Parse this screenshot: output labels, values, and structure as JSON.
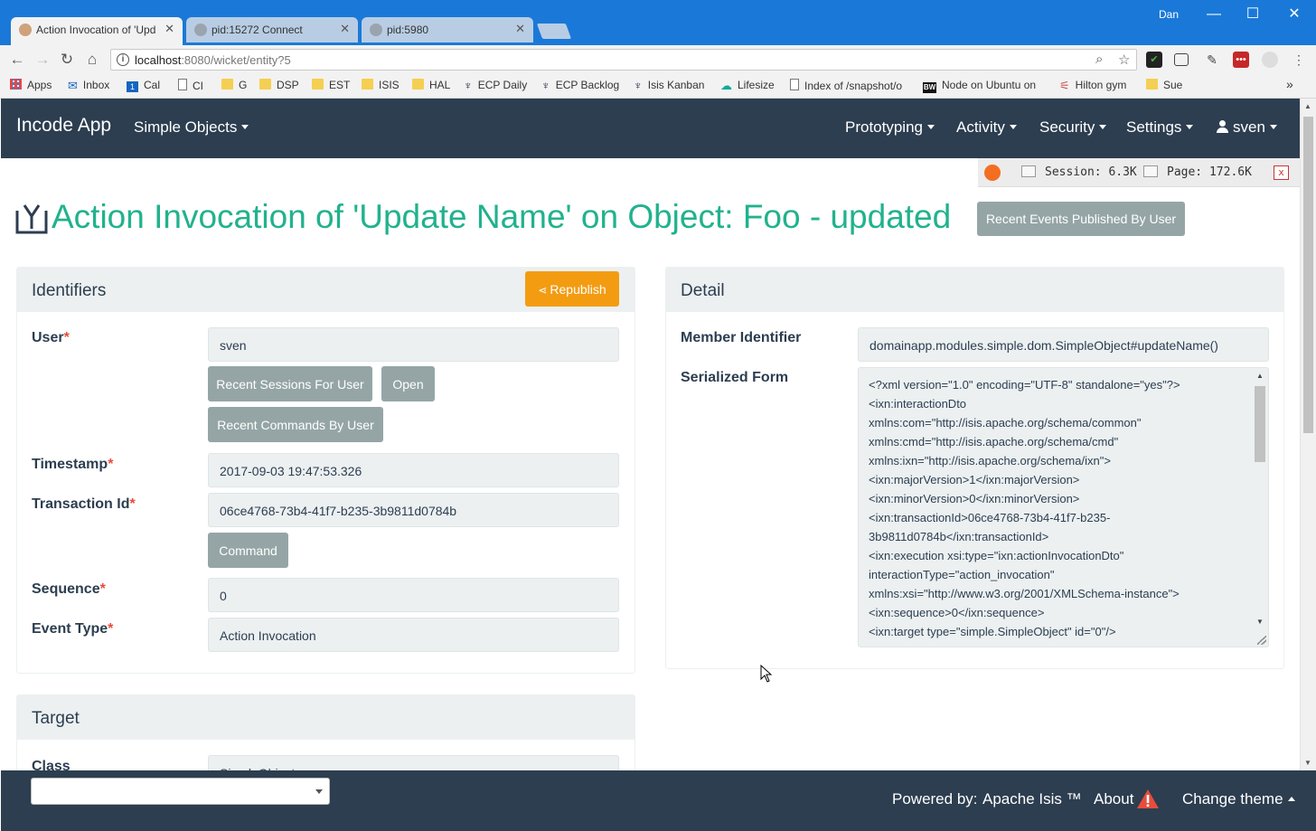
{
  "browser": {
    "user": "Dan",
    "tabs": [
      {
        "title": "Action Invocation of 'Upd"
      },
      {
        "title": "pid:15272 Connect"
      },
      {
        "title": "pid:5980"
      }
    ],
    "url_host": "localhost",
    "url_path": ":8080/wicket/entity?5",
    "bookmarks": [
      "Apps",
      "Inbox",
      "Cal",
      "CI",
      "G",
      "DSP",
      "EST",
      "ISIS",
      "HAL",
      "ECP Daily",
      "ECP Backlog",
      "Isis Kanban",
      "Lifesize",
      "Index of /snapshot/o",
      "Node on Ubuntu on",
      "Hilton gym",
      "Sue"
    ],
    "cal_badge": "1",
    "bw_badge": "BW"
  },
  "navbar": {
    "brand": "Incode App",
    "simple_objects": "Simple Objects",
    "prototyping": "Prototyping",
    "activity": "Activity",
    "security": "Security",
    "settings": "Settings",
    "user": "sven"
  },
  "debug": {
    "session": "Session: 6.3K",
    "page": "Page: 172.6K",
    "close": "x"
  },
  "page": {
    "title": "Action Invocation of 'Update Name' on Object: Foo - updated",
    "recent_events_button": "Recent Events Published By User"
  },
  "identifiers": {
    "heading": "Identifiers",
    "republish": "Republish",
    "user_label": "User",
    "user_value": "sven",
    "recent_sessions": "Recent Sessions For User",
    "open": "Open",
    "recent_commands": "Recent Commands By User",
    "timestamp_label": "Timestamp",
    "timestamp_value": "2017-09-03 19:47:53.326",
    "transaction_label": "Transaction Id",
    "transaction_value": "06ce4768-73b4-41f7-b235-3b9811d0784b",
    "command": "Command",
    "sequence_label": "Sequence",
    "sequence_value": "0",
    "event_type_label": "Event Type",
    "event_type_value": "Action Invocation",
    "required_mark": "*"
  },
  "detail": {
    "heading": "Detail",
    "member_label": "Member Identifier",
    "member_value": "domainapp.modules.simple.dom.SimpleObject#updateName()",
    "serialized_label": "Serialized Form",
    "xml_lines": [
      "<?xml version=\"1.0\" encoding=\"UTF-8\" standalone=\"yes\"?>",
      "<ixn:interactionDto",
      "xmlns:com=\"http://isis.apache.org/schema/common\"",
      "xmlns:cmd=\"http://isis.apache.org/schema/cmd\"",
      "xmlns:ixn=\"http://isis.apache.org/schema/ixn\">",
      "    <ixn:majorVersion>1</ixn:majorVersion>",
      "    <ixn:minorVersion>0</ixn:minorVersion>",
      "    <ixn:transactionId>06ce4768-73b4-41f7-b235-",
      "3b9811d0784b</ixn:transactionId>",
      "    <ixn:execution xsi:type=\"ixn:actionInvocationDto\"",
      "interactionType=\"action_invocation\"",
      "xmlns:xsi=\"http://www.w3.org/2001/XMLSchema-instance\">",
      "        <ixn:sequence>0</ixn:sequence>",
      "        <ixn:target type=\"simple.SimpleObject\" id=\"0\"/>"
    ]
  },
  "target": {
    "heading": "Target",
    "class_label": "Class",
    "class_value": "SimpleObject"
  },
  "footer": {
    "powered_by": "Powered by:",
    "apache_isis": "Apache Isis ™",
    "about": "About",
    "change_theme": "Change theme"
  },
  "colors": {
    "navbar": "#2c3e50",
    "title_green": "#21b28d",
    "button_gray": "#95a5a6",
    "button_orange": "#f39c12",
    "field_bg": "#ecf0f1",
    "required_red": "#e74c3c"
  }
}
